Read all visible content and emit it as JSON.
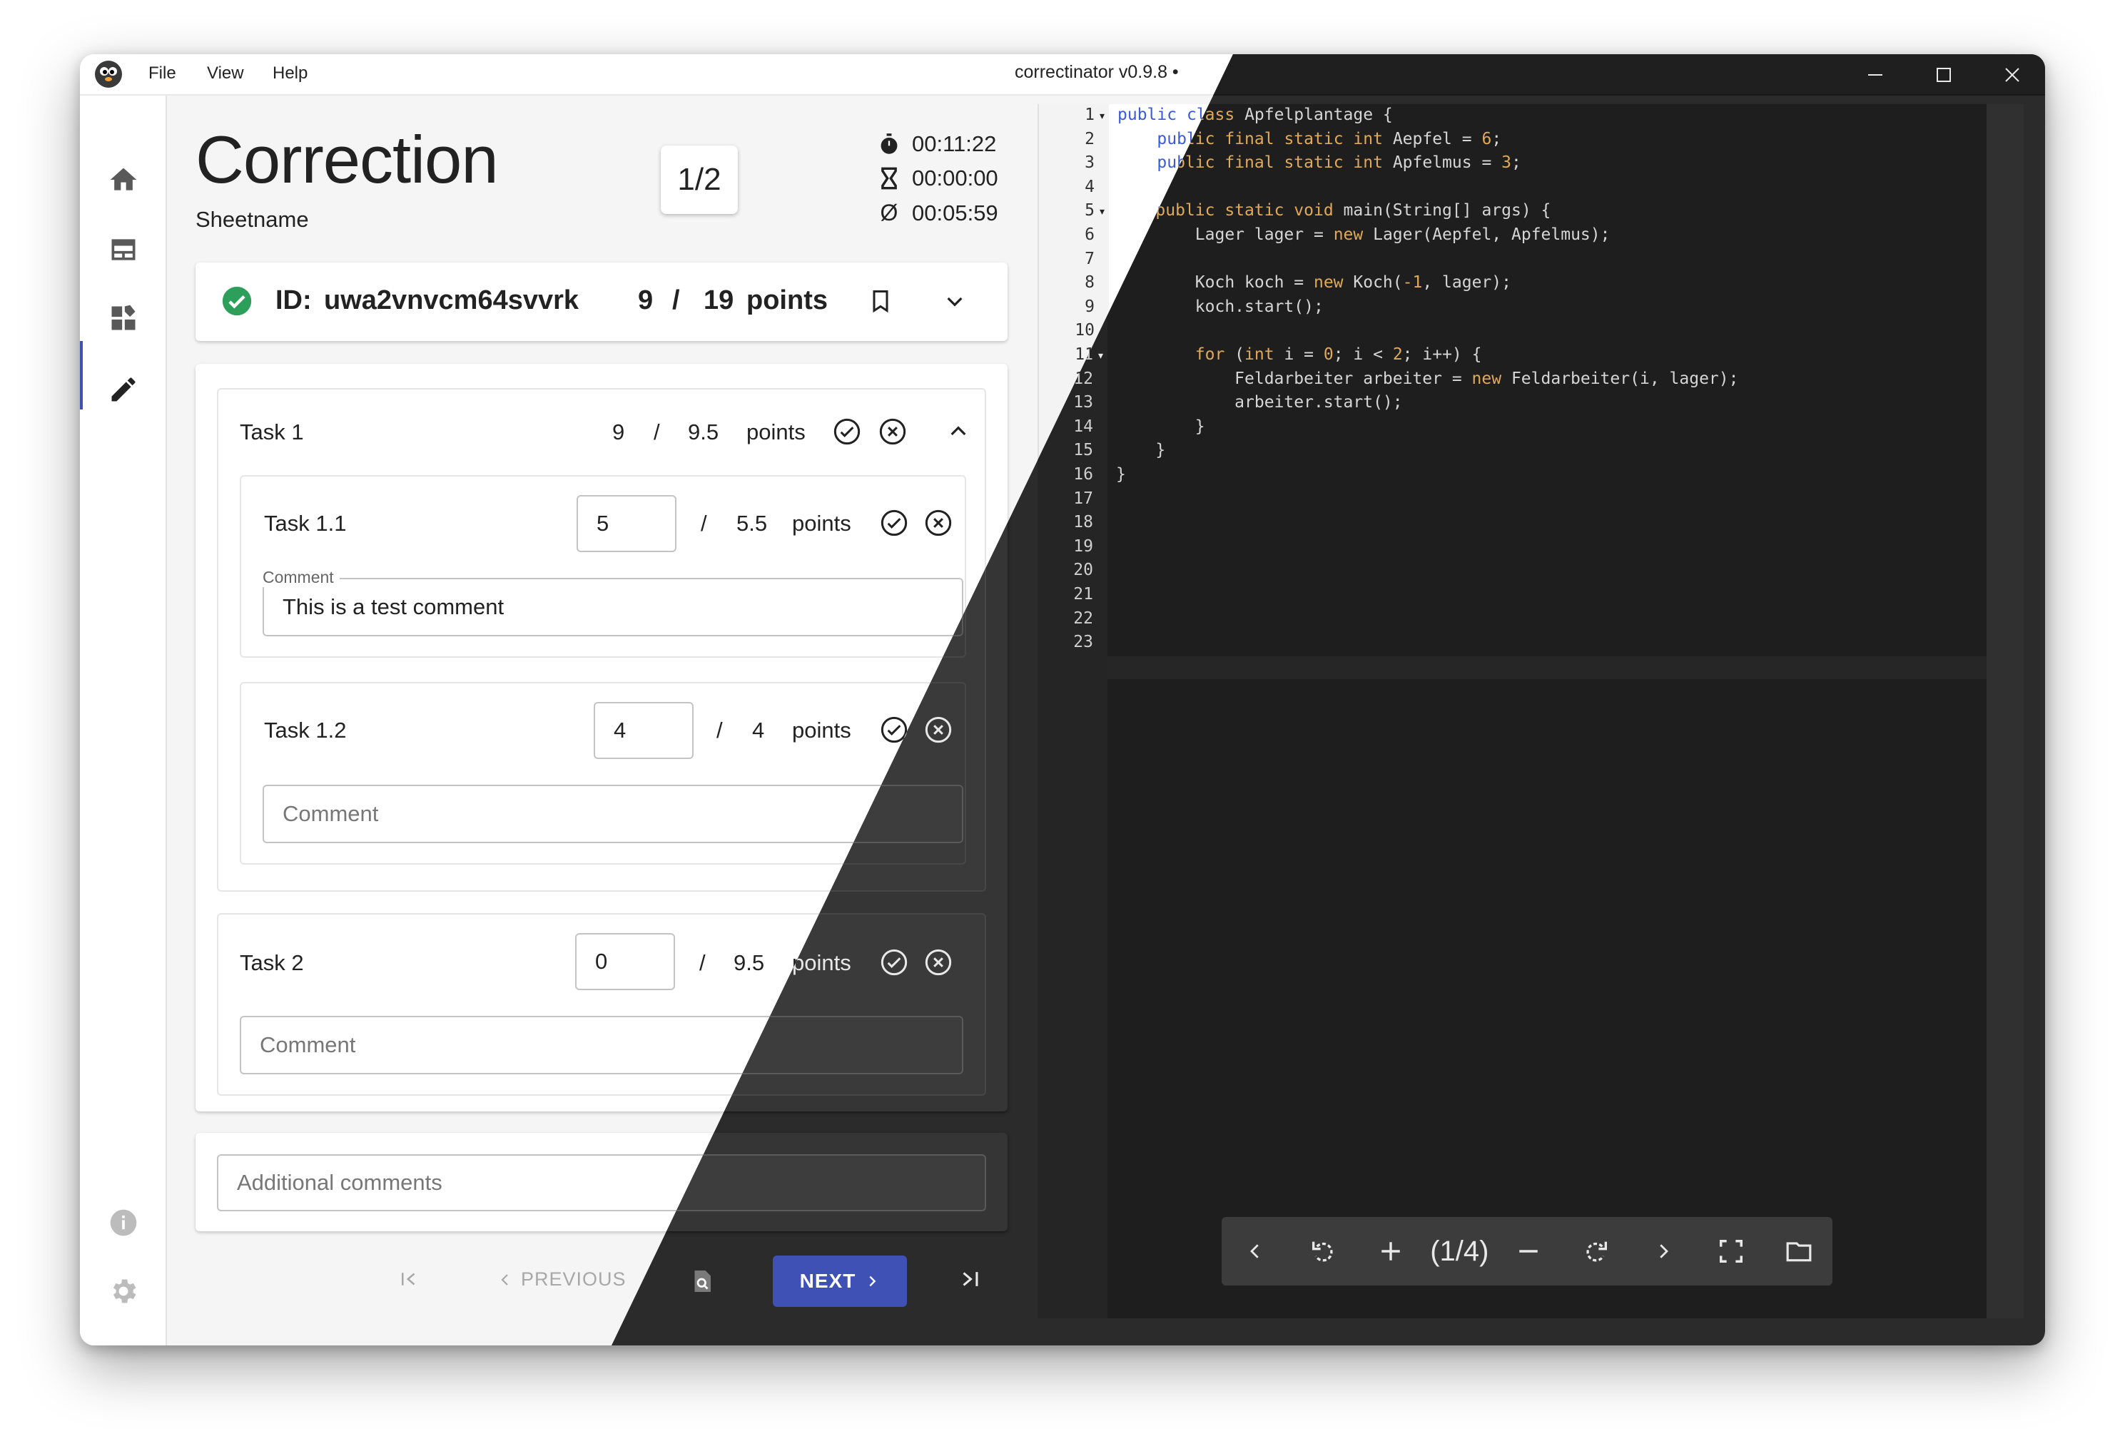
{
  "app": {
    "title": "correctinator v0.9.8 •",
    "menu": [
      "File",
      "View",
      "Help"
    ]
  },
  "colors": {
    "accent": "#3f51b5",
    "success": "#2e9e5b"
  },
  "sidebar": {
    "items": [
      {
        "icon": "home-icon"
      },
      {
        "icon": "table-icon"
      },
      {
        "icon": "dashboard-icon"
      },
      {
        "icon": "edit-pencil-icon",
        "active": true
      }
    ],
    "bottom": [
      {
        "icon": "info-icon"
      },
      {
        "icon": "settings-gear-icon"
      }
    ]
  },
  "header": {
    "title": "Correction",
    "subtitle": "Sheetname",
    "page_indicator": "1/2",
    "timers": [
      "00:11:22",
      "00:00:00",
      "00:05:59"
    ]
  },
  "submission": {
    "id_label": "ID:",
    "id_value": "uwa2vnvcm64svvrk",
    "score": "9",
    "separator": "/",
    "max": "19",
    "unit": "points"
  },
  "tasks": {
    "task1": {
      "name": "Task 1",
      "score": "9",
      "sep": "/",
      "max": "9.5",
      "unit": "points"
    },
    "task11": {
      "name": "Task 1.1",
      "value": "5",
      "sep": "/",
      "max": "5.5",
      "unit": "points",
      "comment_label": "Comment",
      "comment": "This is a test comment"
    },
    "task12": {
      "name": "Task 1.2",
      "value": "4",
      "sep": "/",
      "max": "4",
      "unit": "points",
      "comment_placeholder": "Comment"
    },
    "task2": {
      "name": "Task 2",
      "value": "0",
      "sep": "/",
      "max": "9.5",
      "unit": "points",
      "comment_placeholder": "Comment"
    }
  },
  "additional_comments_placeholder": "Additional comments",
  "navigation": {
    "previous": "PREVIOUS",
    "next": "NEXT"
  },
  "editor": {
    "line_numbers": [
      "1",
      "2",
      "3",
      "4",
      "5",
      "6",
      "7",
      "8",
      "9",
      "10",
      "11",
      "12",
      "13",
      "14",
      "15",
      "16",
      "17",
      "18",
      "19",
      "20",
      "21",
      "22",
      "23"
    ],
    "code_lines": [
      "public class Apfelplantage {",
      "    public final static int Aepfel = 6;",
      "    public final static int Apfelmus = 3;",
      "",
      "    public static void main(String[] args) {",
      "        Lager lager = new Lager(Aepfel, Apfelmus);",
      "",
      "        Koch koch = new Koch(-1, lager);",
      "        koch.start();",
      "",
      "        for (int i = 0; i < 2; i++) {",
      "            Feldarbeiter arbeiter = new Feldarbeiter(i, lager);",
      "            arbeiter.start();",
      "        }",
      "    }",
      "}",
      "",
      "",
      "",
      "",
      "",
      "",
      ""
    ]
  },
  "pdf_toolbar": {
    "page": "(1/4)"
  }
}
